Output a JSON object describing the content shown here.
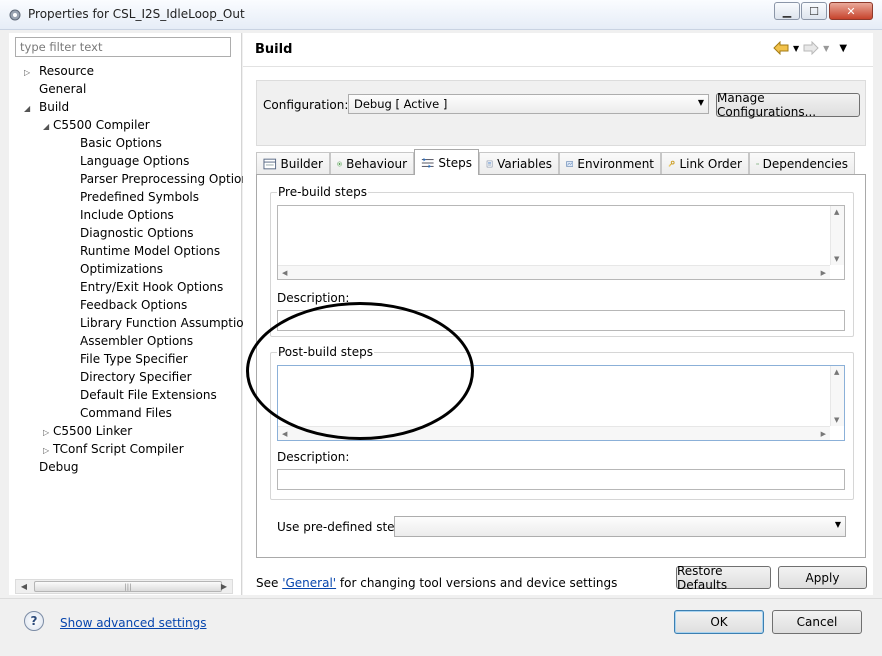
{
  "window": {
    "title": "Properties for CSL_I2S_IdleLoop_Out",
    "controls": {
      "minimize": "▁",
      "maximize": "☐",
      "close": "✕"
    }
  },
  "filter": {
    "placeholder": "type filter text"
  },
  "tree": {
    "items": [
      {
        "label": "Resource",
        "twisty": "▷"
      },
      {
        "label": "General",
        "twisty": ""
      },
      {
        "label": "Build",
        "twisty": "◢"
      },
      {
        "label": "C5500 Compiler",
        "twisty": "◢"
      },
      {
        "label": "Basic Options"
      },
      {
        "label": "Language Options"
      },
      {
        "label": "Parser Preprocessing Options"
      },
      {
        "label": "Predefined Symbols"
      },
      {
        "label": "Include Options"
      },
      {
        "label": "Diagnostic Options"
      },
      {
        "label": "Runtime Model Options"
      },
      {
        "label": "Optimizations"
      },
      {
        "label": "Entry/Exit Hook Options"
      },
      {
        "label": "Feedback Options"
      },
      {
        "label": "Library Function Assumption"
      },
      {
        "label": "Assembler Options"
      },
      {
        "label": "File Type Specifier"
      },
      {
        "label": "Directory Specifier"
      },
      {
        "label": "Default File Extensions"
      },
      {
        "label": "Command Files"
      },
      {
        "label": "C5500 Linker",
        "twisty": "▷"
      },
      {
        "label": "TConf Script Compiler",
        "twisty": "▷"
      },
      {
        "label": "Debug",
        "twisty": ""
      }
    ]
  },
  "page": {
    "title": "Build",
    "configuration_label": "Configuration:",
    "configuration_value": "Debug  [ Active ]",
    "manage_button": "Manage Configurations...",
    "tabs": [
      "Builder",
      "Behaviour",
      "Steps",
      "Variables",
      "Environment",
      "Link Order",
      "Dependencies"
    ],
    "active_tab": "Steps"
  },
  "steps": {
    "prebuild_label": "Pre-build steps",
    "prebuild_description_label": "Description:",
    "postbuild_label": "Post-build steps",
    "postbuild_description_label": "Description:",
    "predefined_label": "Use pre-defined step:",
    "predefined_value": ""
  },
  "footer": {
    "see_text_prefix": "See ",
    "see_link": "'General'",
    "see_text_suffix": " for changing tool versions and device settings",
    "restore_defaults": "Restore Defaults",
    "apply": "Apply",
    "show_advanced": "Show advanced settings",
    "ok": "OK",
    "cancel": "Cancel",
    "help": "?"
  },
  "colors": {
    "accent": "#0645ad",
    "selected_tree_bg": "#ffffff",
    "annotation": "#000000"
  }
}
